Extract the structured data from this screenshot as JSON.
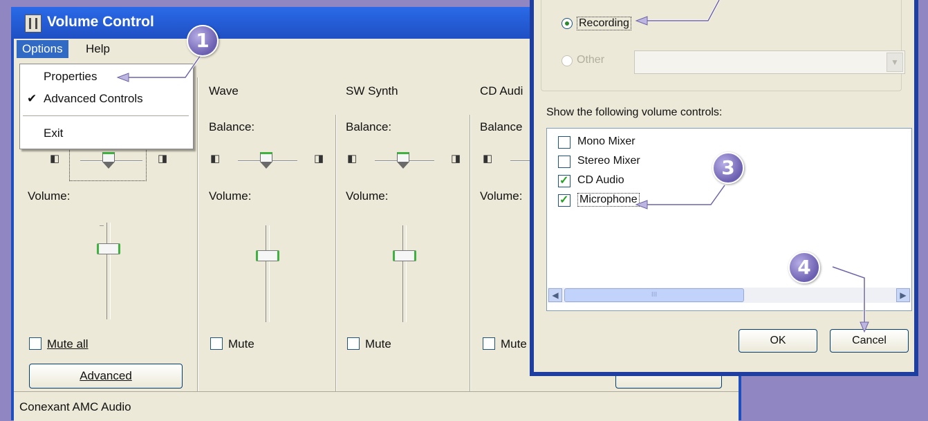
{
  "main_window": {
    "title": "Volume Control",
    "menu": [
      "Options",
      "Help"
    ],
    "status": "Conexant AMC Audio"
  },
  "options_menu": {
    "items": [
      {
        "label": "Properties",
        "checked": false
      },
      {
        "label": "Advanced Controls",
        "checked": true
      },
      {
        "label": "Exit",
        "checked": false
      }
    ]
  },
  "channels": [
    {
      "name": "",
      "balance_label": "",
      "volume_label": "Volume:",
      "mute_label": "Mute all",
      "button": "Advanced"
    },
    {
      "name": "Wave",
      "balance_label": "Balance:",
      "volume_label": "Volume:",
      "mute_label": "Mute"
    },
    {
      "name": "SW Synth",
      "balance_label": "Balance:",
      "volume_label": "Volume:",
      "mute_label": "Mute"
    },
    {
      "name": "CD Audi",
      "balance_label": "Balance",
      "volume_label": "Volume:",
      "mute_label": "Mute"
    }
  ],
  "properties_dialog": {
    "radio_recording": "Recording",
    "radio_other": "Other",
    "show_label": "Show the following volume controls:",
    "controls": [
      {
        "label": "Mono Mixer",
        "checked": false
      },
      {
        "label": "Stereo Mixer",
        "checked": false
      },
      {
        "label": "CD Audio",
        "checked": true
      },
      {
        "label": "Microphone",
        "checked": true
      }
    ],
    "ok": "OK",
    "cancel": "Cancel",
    "scroll_grip": "III"
  },
  "callouts": [
    "1",
    "3",
    "4"
  ],
  "colors": {
    "callout": "#7668bd",
    "title_bar": "#1f4fc3",
    "window_face": "#ece9d8"
  }
}
